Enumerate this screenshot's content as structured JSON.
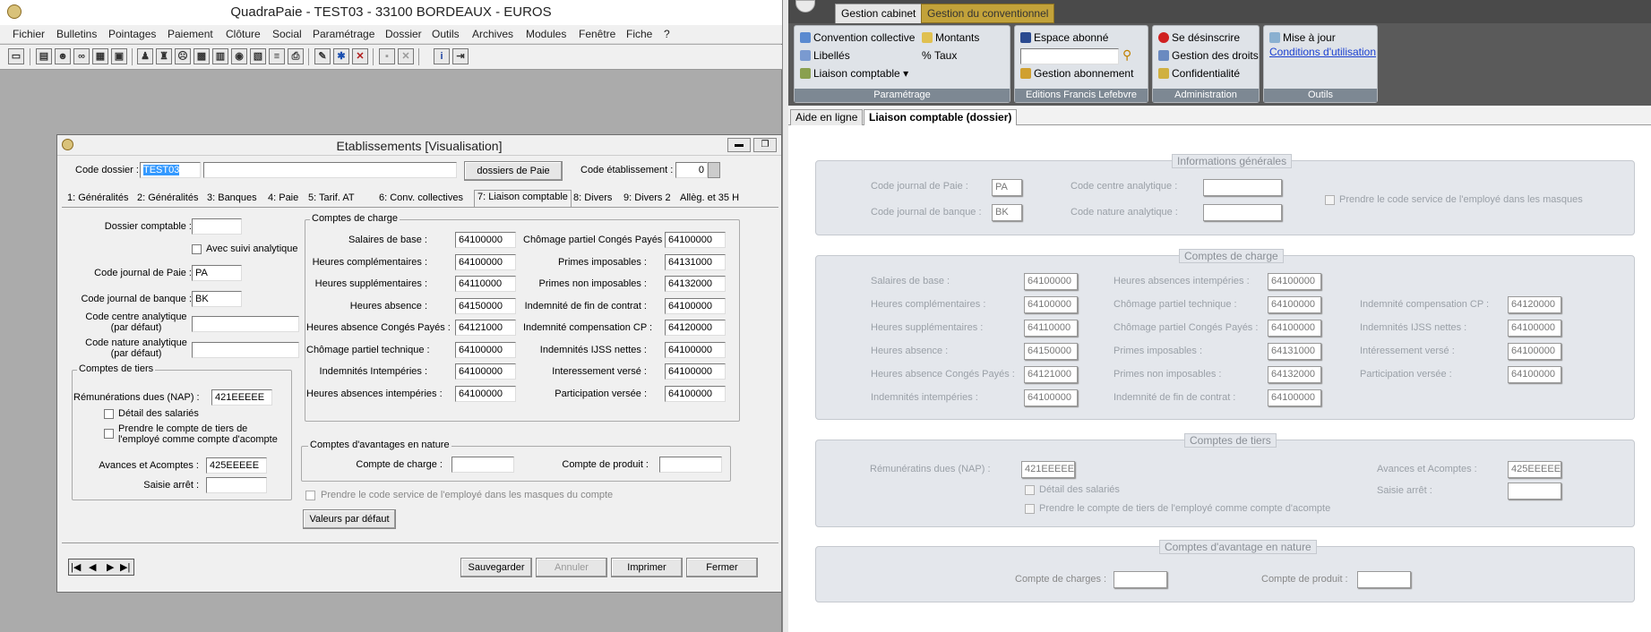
{
  "left": {
    "title": "QuadraPaie - TEST03 -  33100 BORDEAUX - EUROS",
    "menu": [
      "Fichier",
      "Bulletins",
      "Pointages",
      "Paiement",
      "Clôture",
      "Social",
      "Paramétrage",
      "Dossier",
      "Outils",
      "Archives",
      "Modules",
      "Fenêtre",
      "Fiche",
      "?"
    ],
    "dialog": {
      "title": "Etablissements   [Visualisation]",
      "code_dossier_label": "Code dossier :",
      "code_dossier": "TEST03",
      "dossiers_btn": "dossiers de Paie",
      "code_etab_label": "Code établissement :",
      "code_etab": "0",
      "tabs": [
        "1: Généralités",
        "2: Généralités",
        "3: Banques",
        "4: Paie",
        "5: Tarif. AT",
        "6: Conv. collectives",
        "7: Liaison comptable",
        "8: Divers",
        "9: Divers 2",
        "Allèg. et 35 H"
      ],
      "dossier_comptable_label": "Dossier comptable :",
      "suivi_analytique": "Avec suivi analytique",
      "journal_paie_label": "Code journal de Paie :",
      "journal_paie": "PA",
      "journal_banque_label": "Code journal de banque :",
      "journal_banque": "BK",
      "centre_analytique_label1": "Code centre analytique",
      "centre_analytique_label2": "(par défaut)",
      "nature_analytique_label1": "Code nature analytique",
      "nature_analytique_label2": "(par défaut)",
      "tiers_group": "Comptes de tiers",
      "remun_label": "Rémunérations dues (NAP) :",
      "remun": "421EEEEE",
      "detail_salaries": "Détail des salariés",
      "prendre_tiers1": "Prendre le compte de tiers de",
      "prendre_tiers2": "l'employé comme compte d'acompte",
      "avances_label": "Avances et Acomptes :",
      "avances": "425EEEEE",
      "saisie_label": "Saisie arrêt :",
      "charge_group": "Comptes de charge",
      "charges_left": [
        {
          "label": "Salaires de base :",
          "value": "64100000"
        },
        {
          "label": "Heures complémentaires :",
          "value": "64100000"
        },
        {
          "label": "Heures supplémentaires :",
          "value": "64110000"
        },
        {
          "label": "Heures absence :",
          "value": "64150000"
        },
        {
          "label": "Heures absence Congés Payés :",
          "value": "64121000"
        },
        {
          "label": "Chômage partiel technique :",
          "value": "64100000"
        },
        {
          "label": "Indemnités Intempéries :",
          "value": "64100000"
        },
        {
          "label": "Heures absences intempéries :",
          "value": "64100000"
        }
      ],
      "charges_right": [
        {
          "label": "Chômage partiel Congés Payés :",
          "value": "64100000"
        },
        {
          "label": "Primes imposables :",
          "value": "64131000"
        },
        {
          "label": "Primes non imposables :",
          "value": "64132000"
        },
        {
          "label": "Indemnité de fin de contrat :",
          "value": "64100000"
        },
        {
          "label": "Indemnité compensation CP :",
          "value": "64120000"
        },
        {
          "label": "Indemnités IJSS nettes :",
          "value": "64100000"
        },
        {
          "label": "Interessement versé :",
          "value": "64100000"
        },
        {
          "label": "Participation versée :",
          "value": "64100000"
        }
      ],
      "avantages_group": "Comptes d'avantages en nature",
      "compte_charge_label": "Compte de charge :",
      "compte_produit_label": "Compte de produit :",
      "prendre_service": "Prendre le code service de l'employé dans les masques du compte",
      "valeurs_defaut": "Valeurs par défaut",
      "sauvegarder": "Sauvegarder",
      "annuler": "Annuler",
      "imprimer": "Imprimer",
      "fermer": "Fermer"
    }
  },
  "right": {
    "tabs": [
      "Gestion cabinet",
      "Gestion du conventionnel"
    ],
    "ribbon": {
      "parametrage": {
        "items": [
          "Convention collective",
          "Montants",
          "Libellés",
          "Taux",
          "Liaison comptable"
        ],
        "footer": "Paramétrage"
      },
      "editions": {
        "items": [
          "Espace abonné",
          "Gestion abonnement"
        ],
        "footer": "Editions Francis Lefebvre"
      },
      "administration": {
        "items": [
          "Se désinscrire",
          "Gestion des droits",
          "Confidentialité"
        ],
        "footer": "Administration"
      },
      "outils": {
        "items": [
          "Mise à jour",
          "Conditions d'utilisation"
        ],
        "footer": "Outils"
      }
    },
    "subtabs": [
      "Aide en ligne",
      "Liaison comptable (dossier)"
    ],
    "info": {
      "title": "Informations générales",
      "journal_paie_label": "Code journal de Paie :",
      "journal_paie": "PA",
      "journal_banque_label": "Code journal de banque :",
      "journal_banque": "BK",
      "centre_label": "Code centre analytique :",
      "nature_label": "Code nature analytique :",
      "prendre_service": "Prendre le code service de l'employé dans les masques"
    },
    "charge": {
      "title": "Comptes de charge",
      "col1": [
        {
          "label": "Salaires de base :",
          "value": "64100000"
        },
        {
          "label": "Heures complémentaires :",
          "value": "64100000"
        },
        {
          "label": "Heures supplémentaires :",
          "value": "64110000"
        },
        {
          "label": "Heures absence :",
          "value": "64150000"
        },
        {
          "label": "Heures absence Congés Payés :",
          "value": "64121000"
        },
        {
          "label": "Indemnités intempéries :",
          "value": "64100000"
        }
      ],
      "col2": [
        {
          "label": "Heures absences intempéries :",
          "value": "64100000"
        },
        {
          "label": "Chômage partiel technique :",
          "value": "64100000"
        },
        {
          "label": "Chômage partiel Congés Payés :",
          "value": "64100000"
        },
        {
          "label": "Primes imposables :",
          "value": "64131000"
        },
        {
          "label": "Primes non imposables :",
          "value": "64132000"
        },
        {
          "label": "Indemnité de fin de contrat :",
          "value": "64100000"
        }
      ],
      "col3": [
        {
          "label": "Indemnité compensation CP :",
          "value": "64120000"
        },
        {
          "label": "Indemnités IJSS nettes :",
          "value": "64100000"
        },
        {
          "label": "Intéressement versé :",
          "value": "64100000"
        },
        {
          "label": "Participation versée :",
          "value": "64100000"
        }
      ]
    },
    "tiers": {
      "title": "Comptes de tiers",
      "remun_label": "Rémunératins dues (NAP) :",
      "remun": "421EEEEE",
      "avances_label": "Avances et Acomptes :",
      "avances": "425EEEEE",
      "saisie_label": "Saisie arrêt :",
      "detail": "Détail des salariés",
      "prendre": "Prendre le compte de tiers de l'employé comme compte d'acompte"
    },
    "avantages": {
      "title": "Comptes d'avantage en nature",
      "charges_label": "Compte de charges :",
      "produit_label": "Compte de produit :"
    }
  }
}
